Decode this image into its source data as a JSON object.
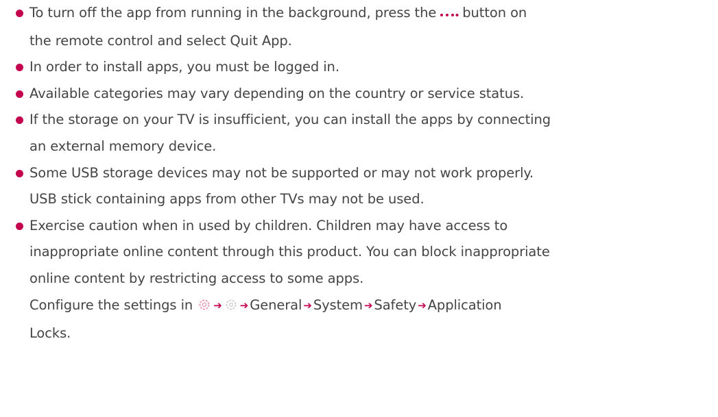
{
  "notes": {
    "bullet_color": "#c4004e",
    "items": [
      {
        "line1_before": "To turn off the app from running in the background, press the",
        "line1_icon": "more-dots-icon",
        "line1_after": "button on",
        "line2": "the remote control and select Quit App."
      },
      {
        "line1": "In order to install apps, you must be logged in."
      },
      {
        "line1": "Available categories may vary depending on the country or service status."
      },
      {
        "line1": "If the storage on your TV is insufficient, you can install the apps by connecting",
        "line2": "an external memory device."
      },
      {
        "line1": "Some USB storage devices may not be supported or may not work properly.",
        "line2": "USB stick containing apps from other TVs may not be used."
      },
      {
        "line1": "Exercise caution when in used by children. Children may have access to",
        "line2": "inappropriate online content through this product. You can block inappropriate",
        "line3": "online content by restricting access to some apps.",
        "path_prefix": "Configure the settings in",
        "path_icons": [
          "settings-icon",
          "all-settings-icon"
        ],
        "path_items": [
          "General",
          "System",
          "Safety",
          "Application"
        ],
        "path_tail": "Locks."
      }
    ]
  }
}
